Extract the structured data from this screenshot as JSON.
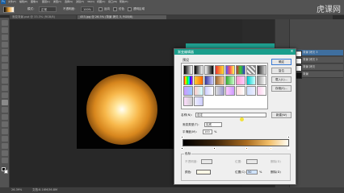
{
  "app": {
    "logo": "Ps",
    "menu": [
      "文件(F)",
      "编辑(E)",
      "图像(I)",
      "图层(L)",
      "类型(Y)",
      "选择(S)",
      "滤镜(T)",
      "3D(D)",
      "视图(V)",
      "窗口(W)",
      "帮助(H)"
    ]
  },
  "options": {
    "mode_label": "模式：",
    "mode_value": "正常",
    "opacity_label": "不透明度：",
    "opacity_value": "100%",
    "reverse_label": "反向",
    "dither_label": "仿色",
    "transparency_label": "透明区域"
  },
  "tabs": [
    {
      "label": "渐变背景.psd @ 33.3% (RGB/8)"
    },
    {
      "label": "453.jpg @ 26.5% (背景 拷贝 3, RGB/8)"
    }
  ],
  "status": {
    "zoom": "26.39%",
    "doc": "文档:8.16M/36.8M"
  },
  "layers": [
    "背景 拷贝 3",
    "背景 拷贝 2",
    "背景 拷贝",
    "背景"
  ],
  "dialog": {
    "title": "渐变编辑器",
    "presets_label": "预设",
    "buttons": {
      "ok": "确定",
      "reset": "复位",
      "load": "载入(L)...",
      "save": "存储(S)..."
    },
    "name_label": "名称(N):",
    "name_value": "自定",
    "new_button": "新建(W)",
    "type_label": "渐变类型(T):",
    "type_value": "实底",
    "smooth_label": "平滑度(M):",
    "smooth_value": "100",
    "smooth_unit": "%",
    "stops_label": "色标",
    "opacity_label": "不透明度:",
    "location_label": "位置:",
    "delete_label": "删除(D)",
    "color_label": "颜色:",
    "color_location_label": "位置(C):",
    "color_location_value": "50",
    "color_delete_label": "删除(D)"
  },
  "watermark": "虎课网",
  "colors": {
    "accent": "#1a9e8c",
    "glow_core": "#fffef6",
    "glow_outer": "#d7861d"
  }
}
